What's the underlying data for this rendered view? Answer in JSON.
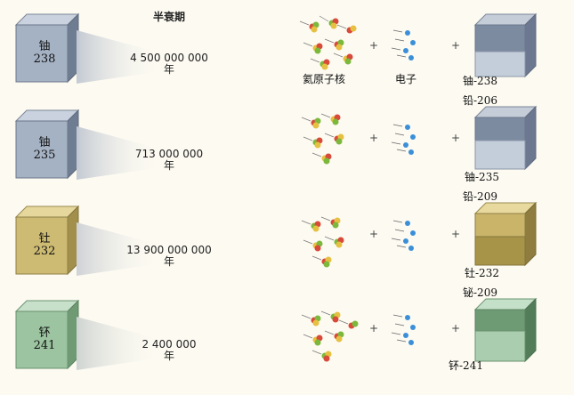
{
  "header": {
    "half_life": "半衰期"
  },
  "captions": {
    "alpha": "氦原子核",
    "electron": "电子"
  },
  "plus": "+",
  "rows": [
    {
      "element": "铀",
      "mass": "238",
      "halflife_value": "4 500 000 000",
      "halflife_unit": "年",
      "top_tag": "",
      "bottom_tag": "铀-238",
      "color": "#9aa7b8"
    },
    {
      "element": "铀",
      "mass": "235",
      "halflife_value": "713 000 000",
      "halflife_unit": "年",
      "top_tag": "铅-206",
      "bottom_tag": "铀-235",
      "color": "#9aa7b8"
    },
    {
      "element": "钍",
      "mass": "232",
      "halflife_value": "13 900 000 000",
      "halflife_unit": "年",
      "top_tag": "铅-209",
      "bottom_tag": "钍-232",
      "color": "#c8b56a"
    },
    {
      "element": "钚",
      "mass": "241",
      "halflife_value": "2 400 000",
      "halflife_unit": "年",
      "top_tag": "铋-209",
      "bottom_tag": "钚-241",
      "color": "#8fb593"
    }
  ]
}
